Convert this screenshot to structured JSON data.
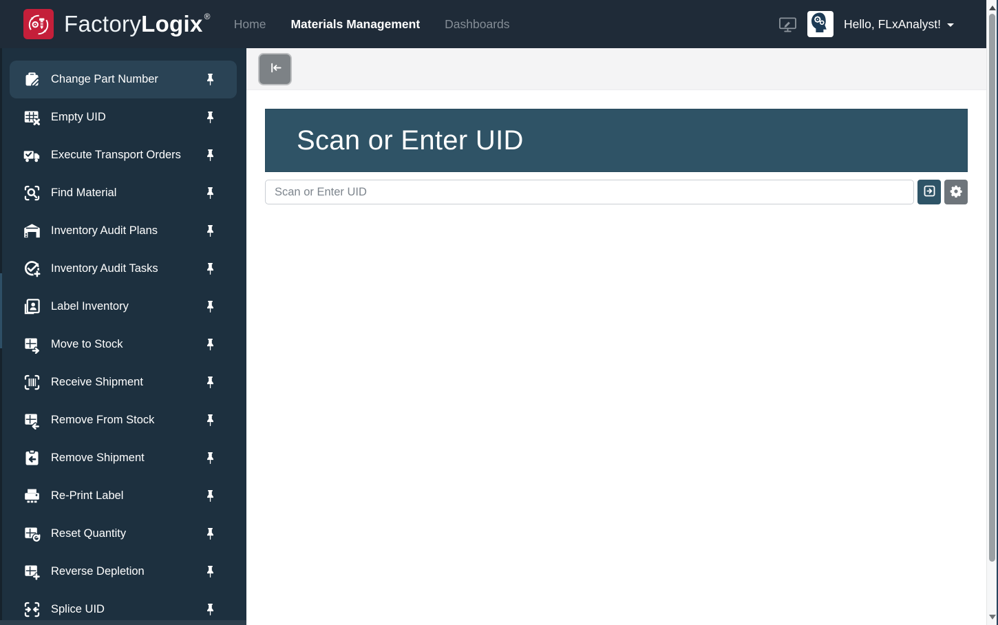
{
  "navbar": {
    "brand": {
      "name_light": "Factory",
      "name_bold": "Logix",
      "registered": "®",
      "logo_icon": "factorylogix-bolt-logo-icon"
    },
    "items": [
      {
        "label": "Home",
        "active": false
      },
      {
        "label": "Materials Management",
        "active": true
      },
      {
        "label": "Dashboards",
        "active": false
      }
    ],
    "right": {
      "monitor_icon": "monitor-edit-icon",
      "avatar_icon": "head-gears-avatar-icon",
      "greeting": "Hello, FLxAnalyst!",
      "caret_icon": "caret-down-icon"
    }
  },
  "sidebar": {
    "pin_icon": "pin-icon",
    "items": [
      {
        "label": "Change Part Number",
        "icon": "briefcase-edit-icon",
        "selected": true
      },
      {
        "label": "Empty UID",
        "icon": "grid-x-icon",
        "selected": false
      },
      {
        "label": "Execute Transport Orders",
        "icon": "truck-check-icon",
        "selected": false
      },
      {
        "label": "Find Material",
        "icon": "scan-search-icon",
        "selected": false
      },
      {
        "label": "Inventory Audit Plans",
        "icon": "warehouse-icon",
        "selected": false
      },
      {
        "label": "Inventory Audit Tasks",
        "icon": "check-plus-icon",
        "selected": false
      },
      {
        "label": "Label Inventory",
        "icon": "id-card-icon",
        "selected": false
      },
      {
        "label": "Move to Stock",
        "icon": "grid-arrow-right-icon",
        "selected": false
      },
      {
        "label": "Receive Shipment",
        "icon": "barcode-scan-icon",
        "selected": false
      },
      {
        "label": "Remove From Stock",
        "icon": "grid-arrow-left-icon",
        "selected": false
      },
      {
        "label": "Remove Shipment",
        "icon": "clipboard-arrow-left-icon",
        "selected": false
      },
      {
        "label": "Re-Print Label",
        "icon": "printer-icon",
        "selected": false
      },
      {
        "label": "Reset Quantity",
        "icon": "grid-refresh-icon",
        "selected": false
      },
      {
        "label": "Reverse Depletion",
        "icon": "grid-plus-icon",
        "selected": false
      },
      {
        "label": "Splice UID",
        "icon": "splice-arrows-icon",
        "selected": false
      }
    ]
  },
  "main": {
    "toolbar": {
      "collapse_button_icon": "collapse-sidebar-icon"
    },
    "panel_title": "Scan or Enter UID",
    "uid_input": {
      "value": "",
      "placeholder": "Scan or Enter UID"
    },
    "submit_icon": "box-arrow-right-icon",
    "settings_icon": "gear-icon"
  },
  "colors": {
    "navbar_bg": "#1f2b38",
    "sidebar_bg": "#1d303f",
    "sidebar_selected": "#2a4355",
    "panel_bg": "#2f5366",
    "brand_red": "#c41f3a",
    "submit_button": "#2e5467",
    "settings_button": "#6e757b"
  }
}
